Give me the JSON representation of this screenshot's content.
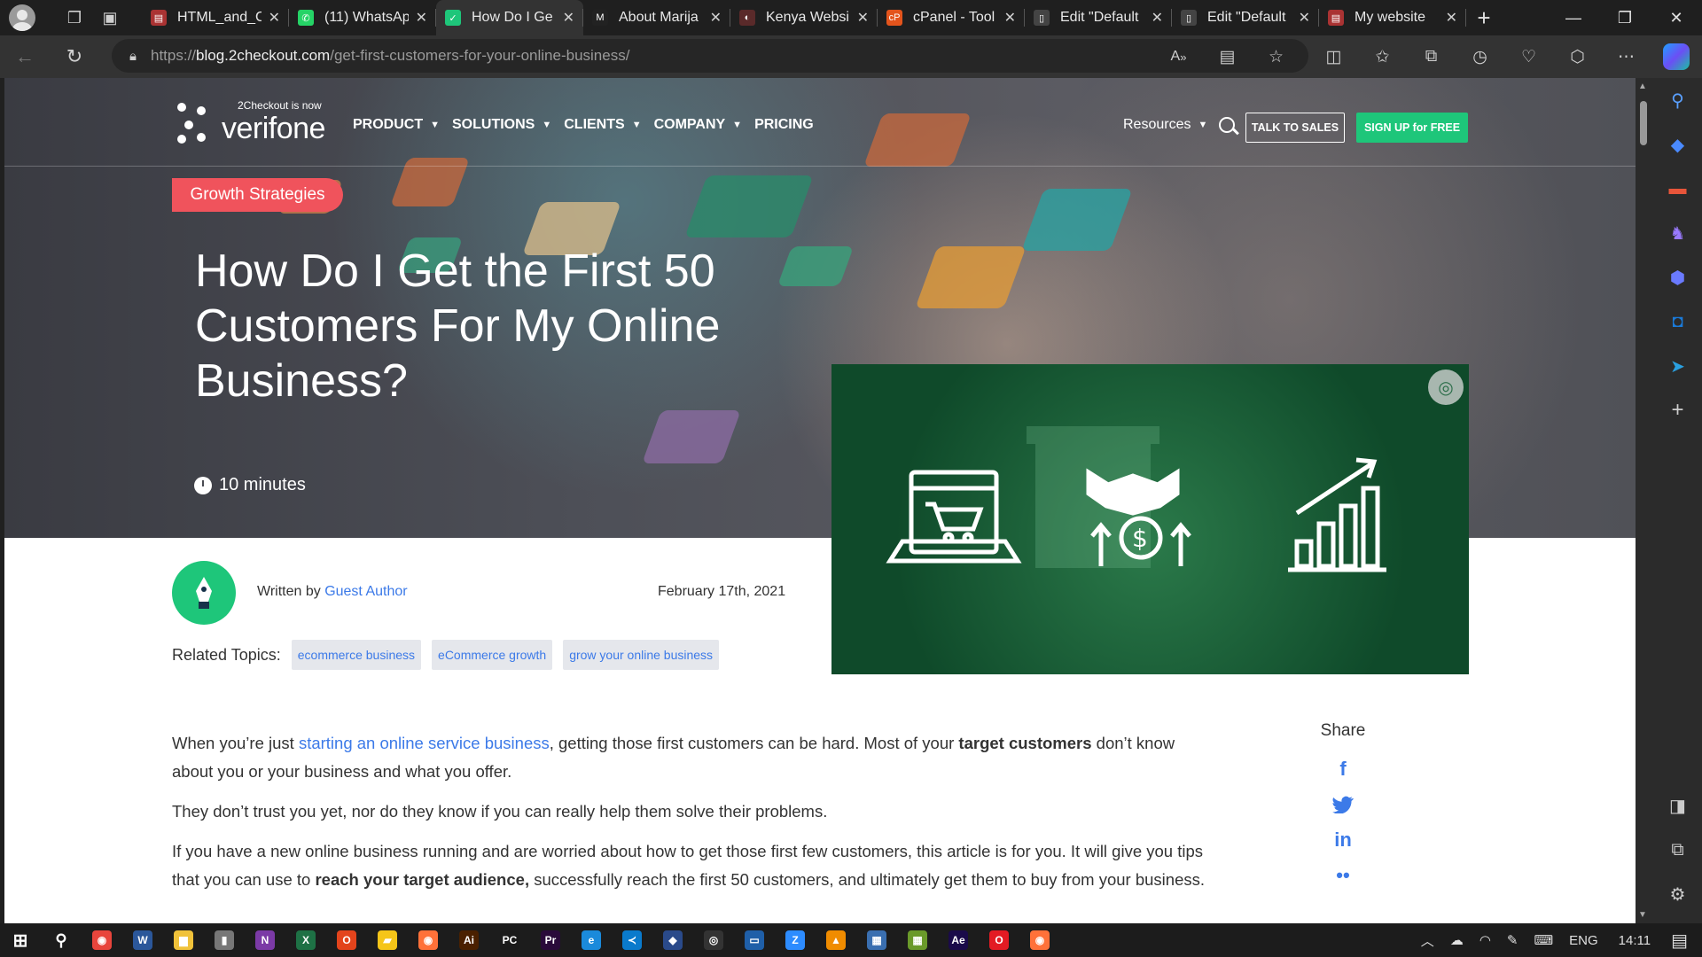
{
  "browser": {
    "tabs": [
      {
        "title": "HTML_and_C",
        "fav_color": "#a33",
        "fav": "▤"
      },
      {
        "title": "(11) WhatsAp",
        "fav_color": "#25d366",
        "fav": "✆"
      },
      {
        "title": "How Do I Ge",
        "fav_color": "#1ec67a",
        "fav": "✓",
        "active": true
      },
      {
        "title": "About Marija",
        "fav_color": "#222",
        "fav": "M"
      },
      {
        "title": "Kenya Websi",
        "fav_color": "#5a2a2a",
        "fav": "◐"
      },
      {
        "title": "cPanel - Tool",
        "fav_color": "#e3541c",
        "fav": "cP"
      },
      {
        "title": "Edit \"Default",
        "fav_color": "#444",
        "fav": "▯"
      },
      {
        "title": "Edit \"Default",
        "fav_color": "#444",
        "fav": "▯"
      },
      {
        "title": "My website",
        "fav_color": "#a33",
        "fav": "▤"
      }
    ],
    "url": {
      "scheme": "https://",
      "host": "blog.2checkout.com",
      "path": "/get-first-customers-for-your-online-business/"
    }
  },
  "site": {
    "logo_small": "2Checkout is now",
    "logo_word": "verifone",
    "nav": [
      "PRODUCT",
      "SOLUTIONS",
      "CLIENTS",
      "COMPANY",
      "PRICING"
    ],
    "resources": "Resources",
    "talk": "TALK TO SALES",
    "signup": "SIGN UP for FREE"
  },
  "hero": {
    "category": "Growth Strategies",
    "title": "How Do I Get the First 50 Customers For My Online Business?",
    "read_time": "10 minutes"
  },
  "meta": {
    "written_by": "Written by",
    "author": "Guest Author",
    "date": "February 17th, 2021",
    "topics_label": "Related Topics:",
    "topics": [
      "ecommerce business",
      "eCommerce growth",
      "grow your online business"
    ]
  },
  "article": {
    "p1_a": "When you’re just ",
    "p1_link": "starting an online service business",
    "p1_b": ", getting those first customers can be hard. Most of your ",
    "p1_bold": "target customers",
    "p1_c": " don’t know about you or your business and what you offer.",
    "p2": "They don’t trust you yet, nor do they know if you can really help them solve their problems.",
    "p3_a": "If you have a new online business running and are worried about how to get those first few customers, this article is for you. It will give you tips that you can use to ",
    "p3_bold": "reach your target audience,",
    "p3_b": " successfully reach the first 50 customers, and ultimately get them to buy from your business."
  },
  "share": {
    "title": "Share",
    "icons": [
      "facebook-icon",
      "twitter-icon",
      "linkedin-icon",
      "more-icon"
    ]
  },
  "taskbar": {
    "lang": "ENG",
    "time": "14:11",
    "apps": [
      {
        "name": "chrome",
        "color": "#e8453c",
        "label": "◉"
      },
      {
        "name": "word",
        "color": "#2b579a",
        "label": "W"
      },
      {
        "name": "explorer",
        "color": "#f0c23a",
        "label": "▆"
      },
      {
        "name": "usb",
        "color": "#777",
        "label": "▮"
      },
      {
        "name": "onenote",
        "color": "#7b3aa6",
        "label": "N"
      },
      {
        "name": "excel",
        "color": "#1e7145",
        "label": "X"
      },
      {
        "name": "office",
        "color": "#e3441c",
        "label": "O"
      },
      {
        "name": "sticky",
        "color": "#f5c518",
        "label": "▰"
      },
      {
        "name": "firefox",
        "color": "#ff7139",
        "label": "◉"
      },
      {
        "name": "illustrator",
        "color": "#4a2000",
        "label": "Ai"
      },
      {
        "name": "pycharm",
        "color": "#1a1a1a",
        "label": "PC"
      },
      {
        "name": "premiere",
        "color": "#2a0a3a",
        "label": "Pr"
      },
      {
        "name": "edge",
        "color": "#1b8adb",
        "label": "e"
      },
      {
        "name": "vscode",
        "color": "#0a7acc",
        "label": "≺"
      },
      {
        "name": "app2",
        "color": "#2a4a8a",
        "label": "◆"
      },
      {
        "name": "obs",
        "color": "#333",
        "label": "◎"
      },
      {
        "name": "screen",
        "color": "#1f5fa8",
        "label": "▭"
      },
      {
        "name": "zoom",
        "color": "#2d8cff",
        "label": "Z"
      },
      {
        "name": "vlc",
        "color": "#f08c00",
        "label": "▲"
      },
      {
        "name": "app3",
        "color": "#3a6fb0",
        "label": "▦"
      },
      {
        "name": "app4",
        "color": "#6a9a2a",
        "label": "▦"
      },
      {
        "name": "aftereffects",
        "color": "#1a0a4a",
        "label": "Ae"
      },
      {
        "name": "opera",
        "color": "#e31b23",
        "label": "O"
      },
      {
        "name": "firefox2",
        "color": "#ff7139",
        "label": "◉"
      }
    ]
  }
}
